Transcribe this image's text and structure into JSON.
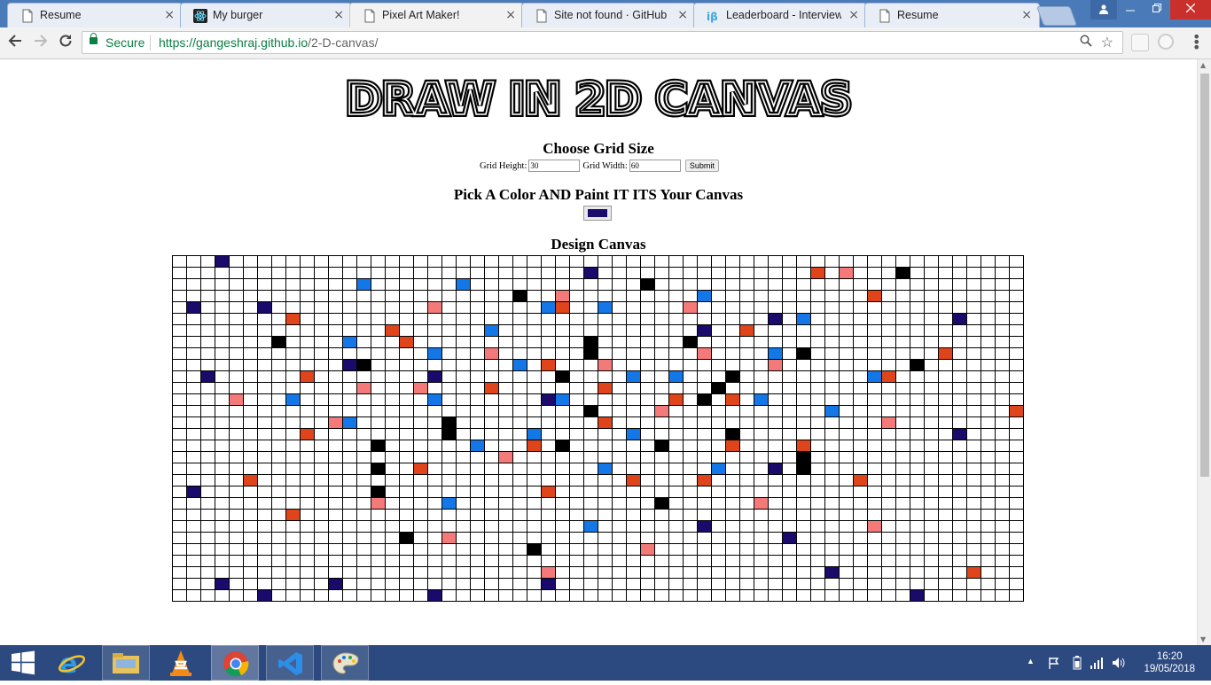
{
  "browser": {
    "tabs": [
      {
        "title": "Resume",
        "icon": "document-icon"
      },
      {
        "title": "My burger",
        "icon": "react-icon"
      },
      {
        "title": "Pixel Art Maker!",
        "icon": "document-icon",
        "active": true
      },
      {
        "title": "Site not found · GitHub P",
        "icon": "document-icon"
      },
      {
        "title": "Leaderboard - InterviewB",
        "icon": "interviewbit-icon"
      },
      {
        "title": "Resume",
        "icon": "document-icon"
      }
    ],
    "close_glyph": "×",
    "secure_label": "Secure",
    "url_host": "https://gangeshraj.github.io",
    "url_path": "/2-D-canvas/"
  },
  "page": {
    "banner": "DRAW IN 2D CANVAS",
    "grid_title": "Choose Grid Size",
    "height_label": "Grid Height:",
    "height_value": "30",
    "width_label": "Grid Width:",
    "width_value": "60",
    "submit_label": "Submit",
    "color_title": "Pick A Color AND Paint IT ITS Your Canvas",
    "selected_color": "#1a0a6b",
    "canvas_title": "Design Canvas"
  },
  "canvas": {
    "rows": 30,
    "cols": 60,
    "palette": {
      "N": "#1a0a6b",
      "O": "#e0441a",
      "P": "#f47a7a",
      "B": "#1477e8",
      "K": "#000000"
    },
    "painted": [
      [
        0,
        3,
        "N"
      ],
      [
        1,
        29,
        "N"
      ],
      [
        1,
        45,
        "O"
      ],
      [
        1,
        47,
        "P"
      ],
      [
        1,
        51,
        "K"
      ],
      [
        2,
        13,
        "B"
      ],
      [
        2,
        20,
        "B"
      ],
      [
        2,
        33,
        "K"
      ],
      [
        3,
        24,
        "K"
      ],
      [
        3,
        27,
        "P"
      ],
      [
        3,
        37,
        "B"
      ],
      [
        3,
        49,
        "O"
      ],
      [
        4,
        1,
        "N"
      ],
      [
        4,
        6,
        "N"
      ],
      [
        4,
        18,
        "P"
      ],
      [
        4,
        26,
        "B"
      ],
      [
        4,
        27,
        "O"
      ],
      [
        4,
        30,
        "B"
      ],
      [
        4,
        36,
        "P"
      ],
      [
        5,
        8,
        "O"
      ],
      [
        5,
        42,
        "N"
      ],
      [
        5,
        44,
        "B"
      ],
      [
        5,
        55,
        "N"
      ],
      [
        6,
        15,
        "O"
      ],
      [
        6,
        22,
        "B"
      ],
      [
        6,
        37,
        "N"
      ],
      [
        6,
        40,
        "O"
      ],
      [
        7,
        7,
        "K"
      ],
      [
        7,
        12,
        "B"
      ],
      [
        7,
        16,
        "O"
      ],
      [
        7,
        29,
        "K"
      ],
      [
        7,
        36,
        "K"
      ],
      [
        8,
        18,
        "B"
      ],
      [
        8,
        22,
        "P"
      ],
      [
        8,
        29,
        "K"
      ],
      [
        8,
        37,
        "P"
      ],
      [
        8,
        42,
        "B"
      ],
      [
        8,
        44,
        "K"
      ],
      [
        8,
        54,
        "O"
      ],
      [
        9,
        12,
        "N"
      ],
      [
        9,
        13,
        "K"
      ],
      [
        9,
        24,
        "B"
      ],
      [
        9,
        26,
        "O"
      ],
      [
        9,
        30,
        "P"
      ],
      [
        9,
        42,
        "P"
      ],
      [
        9,
        52,
        "K"
      ],
      [
        10,
        2,
        "N"
      ],
      [
        10,
        9,
        "O"
      ],
      [
        10,
        18,
        "N"
      ],
      [
        10,
        27,
        "K"
      ],
      [
        10,
        32,
        "B"
      ],
      [
        10,
        35,
        "B"
      ],
      [
        10,
        39,
        "K"
      ],
      [
        10,
        49,
        "B"
      ],
      [
        10,
        50,
        "O"
      ],
      [
        11,
        13,
        "P"
      ],
      [
        11,
        17,
        "P"
      ],
      [
        11,
        22,
        "O"
      ],
      [
        11,
        30,
        "O"
      ],
      [
        11,
        38,
        "K"
      ],
      [
        12,
        4,
        "P"
      ],
      [
        12,
        8,
        "B"
      ],
      [
        12,
        18,
        "B"
      ],
      [
        12,
        26,
        "N"
      ],
      [
        12,
        27,
        "B"
      ],
      [
        12,
        35,
        "O"
      ],
      [
        12,
        37,
        "K"
      ],
      [
        12,
        39,
        "O"
      ],
      [
        12,
        41,
        "B"
      ],
      [
        13,
        29,
        "K"
      ],
      [
        13,
        34,
        "P"
      ],
      [
        13,
        46,
        "B"
      ],
      [
        13,
        59,
        "O"
      ],
      [
        14,
        11,
        "P"
      ],
      [
        14,
        12,
        "B"
      ],
      [
        14,
        19,
        "K"
      ],
      [
        14,
        30,
        "O"
      ],
      [
        14,
        50,
        "P"
      ],
      [
        15,
        9,
        "O"
      ],
      [
        15,
        19,
        "K"
      ],
      [
        15,
        25,
        "B"
      ],
      [
        15,
        32,
        "B"
      ],
      [
        15,
        39,
        "K"
      ],
      [
        15,
        55,
        "N"
      ],
      [
        16,
        14,
        "K"
      ],
      [
        16,
        21,
        "B"
      ],
      [
        16,
        25,
        "O"
      ],
      [
        16,
        27,
        "K"
      ],
      [
        16,
        34,
        "K"
      ],
      [
        16,
        39,
        "O"
      ],
      [
        16,
        44,
        "O"
      ],
      [
        17,
        23,
        "P"
      ],
      [
        17,
        44,
        "K"
      ],
      [
        18,
        14,
        "K"
      ],
      [
        18,
        17,
        "O"
      ],
      [
        18,
        30,
        "B"
      ],
      [
        18,
        38,
        "B"
      ],
      [
        18,
        42,
        "N"
      ],
      [
        18,
        44,
        "K"
      ],
      [
        19,
        5,
        "O"
      ],
      [
        19,
        32,
        "O"
      ],
      [
        19,
        37,
        "O"
      ],
      [
        19,
        48,
        "O"
      ],
      [
        20,
        1,
        "N"
      ],
      [
        20,
        14,
        "K"
      ],
      [
        20,
        26,
        "O"
      ],
      [
        21,
        14,
        "P"
      ],
      [
        21,
        19,
        "B"
      ],
      [
        21,
        34,
        "K"
      ],
      [
        21,
        41,
        "P"
      ],
      [
        22,
        8,
        "O"
      ],
      [
        23,
        29,
        "B"
      ],
      [
        23,
        37,
        "N"
      ],
      [
        23,
        49,
        "P"
      ],
      [
        24,
        16,
        "K"
      ],
      [
        24,
        19,
        "P"
      ],
      [
        24,
        43,
        "N"
      ],
      [
        25,
        25,
        "K"
      ],
      [
        25,
        33,
        "P"
      ],
      [
        27,
        26,
        "P"
      ],
      [
        27,
        46,
        "N"
      ],
      [
        27,
        56,
        "O"
      ],
      [
        28,
        3,
        "N"
      ],
      [
        28,
        11,
        "N"
      ],
      [
        28,
        26,
        "N"
      ],
      [
        29,
        6,
        "N"
      ],
      [
        29,
        18,
        "N"
      ],
      [
        29,
        52,
        "N"
      ]
    ]
  },
  "taskbar": {
    "time": "16:20",
    "date": "19/05/2018",
    "apps": [
      "start-button",
      "internet-explorer-icon",
      "file-explorer-icon",
      "vlc-icon",
      "chrome-icon",
      "vscode-icon",
      "paint-icon"
    ]
  }
}
